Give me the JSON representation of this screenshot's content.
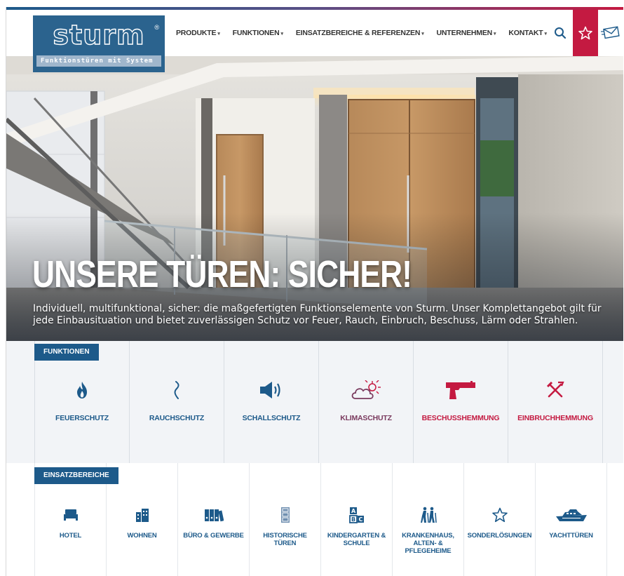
{
  "brand": {
    "logo_text": "sturm",
    "reg_mark": "®",
    "tagline": "Funktionstüren mit System",
    "primary_color": "#1d5a8a",
    "accent_color": "#c41a41"
  },
  "nav": {
    "items": [
      {
        "label": "Produkte"
      },
      {
        "label": "Funktionen"
      },
      {
        "label": "Einsatzbereiche & Referenzen"
      },
      {
        "label": "Unternehmen"
      },
      {
        "label": "Kontakt"
      }
    ],
    "caret": "▾",
    "icons": [
      "search-icon",
      "star-icon",
      "mail-icon"
    ]
  },
  "hero": {
    "title": "UNSERE TÜREN: SICHER!",
    "text": "Individuell, multifunktional, sicher: die maßgefertigten Funktionselemente von Sturm. Unser Komplettangebot gilt für jede Einbausituation und bietet zuverlässigen Schutz vor Feuer, Rauch, Einbruch, Beschuss, Lärm oder Strahlen."
  },
  "funktionen": {
    "title": "Funktionen",
    "items": [
      {
        "label": "Feuerschutz",
        "icon": "flame-icon",
        "color": "#1d5a8a"
      },
      {
        "label": "Rauchschutz",
        "icon": "smoke-icon",
        "color": "#1d5a8a"
      },
      {
        "label": "Schallschutz",
        "icon": "speaker-icon",
        "color": "#1d5a8a"
      },
      {
        "label": "Klimaschutz",
        "icon": "cloud-sun-icon",
        "color": "#7a3a5e"
      },
      {
        "label": "Beschusshemmung",
        "icon": "pistol-icon",
        "color": "#c41a41"
      },
      {
        "label": "Einbruchhemmung",
        "icon": "crossed-tools-icon",
        "color": "#c41a41"
      }
    ]
  },
  "einsatzbereiche": {
    "title": "Einsatzbereiche",
    "items": [
      {
        "label": "Hotel",
        "icon": "bed-icon"
      },
      {
        "label": "Wohnen",
        "icon": "apartment-icon"
      },
      {
        "label": "Büro & Gewerbe",
        "icon": "binders-icon"
      },
      {
        "label": "Historische Türen",
        "icon": "historic-door-icon"
      },
      {
        "label": "Kindergarten &\nSchule",
        "icon": "abc-blocks-icon"
      },
      {
        "label": "Krankenhaus,\nAlten- &\nPflegeheime",
        "icon": "elderly-icon"
      },
      {
        "label": "Sonderlösungen",
        "icon": "star-outline-icon"
      },
      {
        "label": "Yachttüren",
        "icon": "yacht-icon"
      }
    ]
  }
}
